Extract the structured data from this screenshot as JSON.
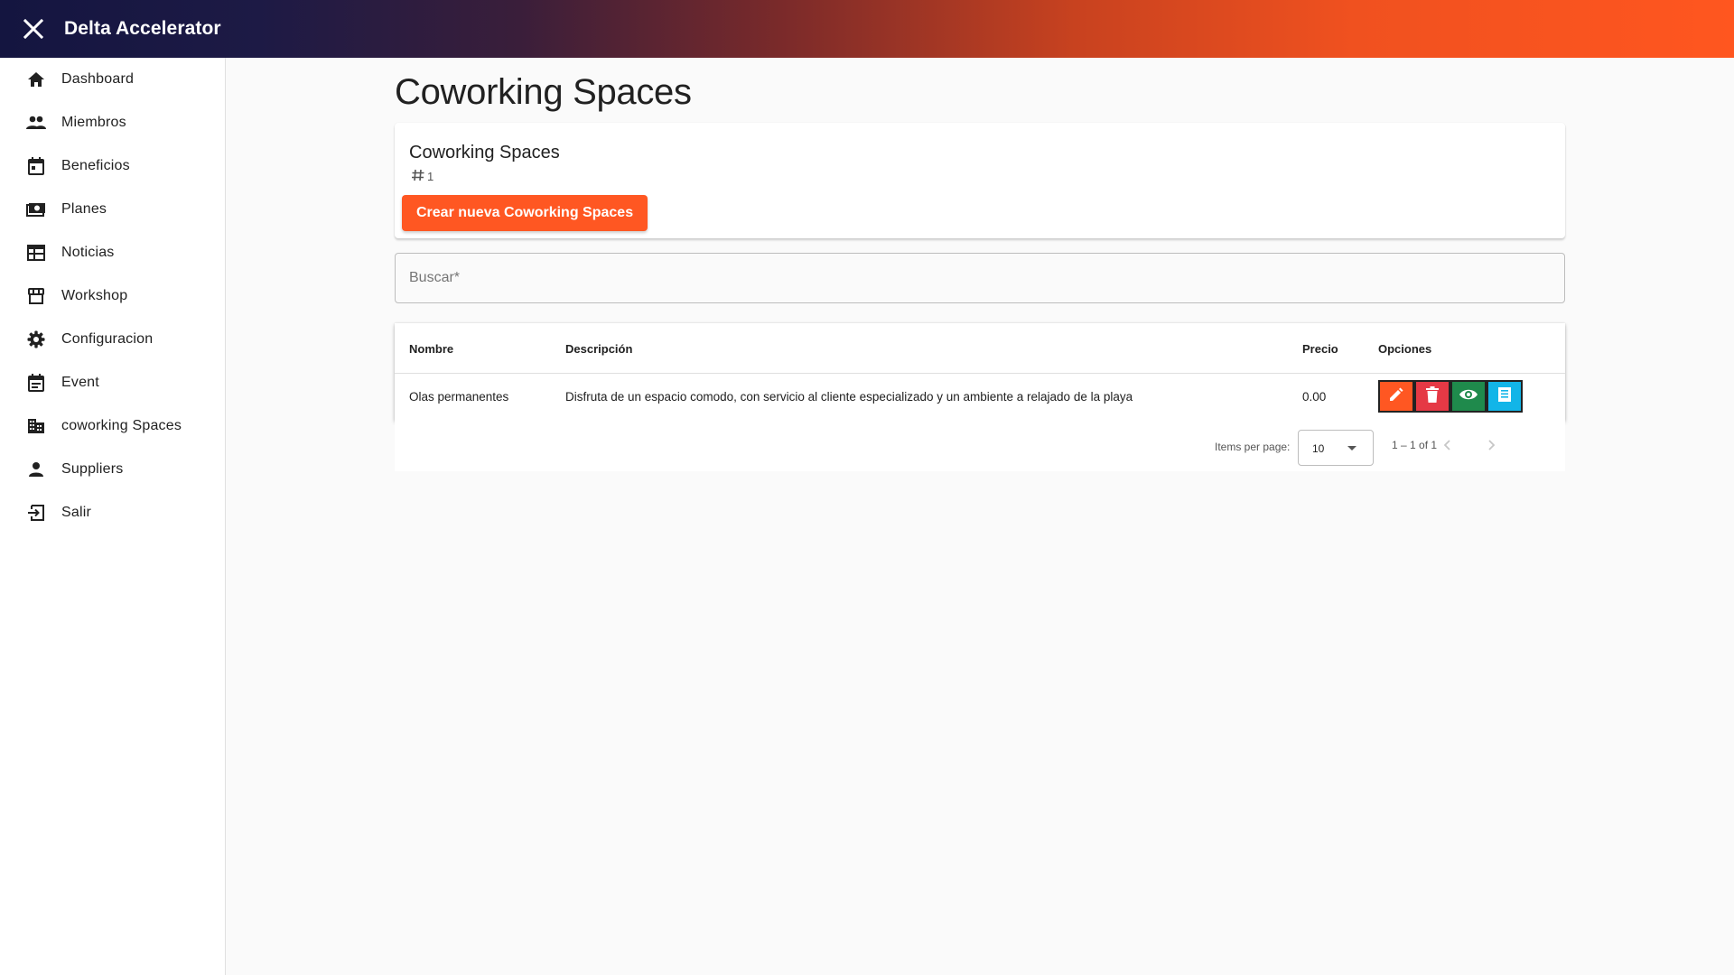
{
  "app": {
    "title": "Delta Accelerator",
    "close_icon": "close-icon"
  },
  "sidebar": {
    "items": [
      {
        "label": "Dashboard",
        "icon": "home-icon"
      },
      {
        "label": "Miembros",
        "icon": "people-icon"
      },
      {
        "label": "Beneficios",
        "icon": "calendar-icon"
      },
      {
        "label": "Planes",
        "icon": "money-icon"
      },
      {
        "label": "Noticias",
        "icon": "web-icon"
      },
      {
        "label": "Workshop",
        "icon": "store-icon"
      },
      {
        "label": "Configuracion",
        "icon": "gear-icon"
      },
      {
        "label": "Event",
        "icon": "event-icon"
      },
      {
        "label": "coworking Spaces",
        "icon": "domain-icon"
      },
      {
        "label": "Suppliers",
        "icon": "person-icon"
      },
      {
        "label": "Salir",
        "icon": "logout-icon"
      }
    ]
  },
  "page": {
    "title": "Coworking Spaces"
  },
  "summary_card": {
    "title": "Coworking Spaces",
    "count": "1",
    "create_button": "Crear nueva Coworking Spaces"
  },
  "search": {
    "placeholder": "Buscar*",
    "value": ""
  },
  "table": {
    "headers": {
      "nombre": "Nombre",
      "descripcion": "Descripción",
      "precio": "Precio",
      "opciones": "Opciones"
    },
    "rows": [
      {
        "nombre": "Olas permanentes",
        "descripcion": "Disfruta de un espacio comodo, con servicio al cliente especializado y un ambiente a relajado de la playa",
        "precio": "0.00"
      }
    ]
  },
  "paginator": {
    "items_per_page_label": "Items per page:",
    "items_per_page": "10",
    "range": "1 – 1 of 1"
  },
  "colors": {
    "accent": "#ff5722",
    "edit": "#ff5722",
    "delete": "#e53945",
    "view": "#1f8a4c",
    "document": "#12b5e8"
  }
}
